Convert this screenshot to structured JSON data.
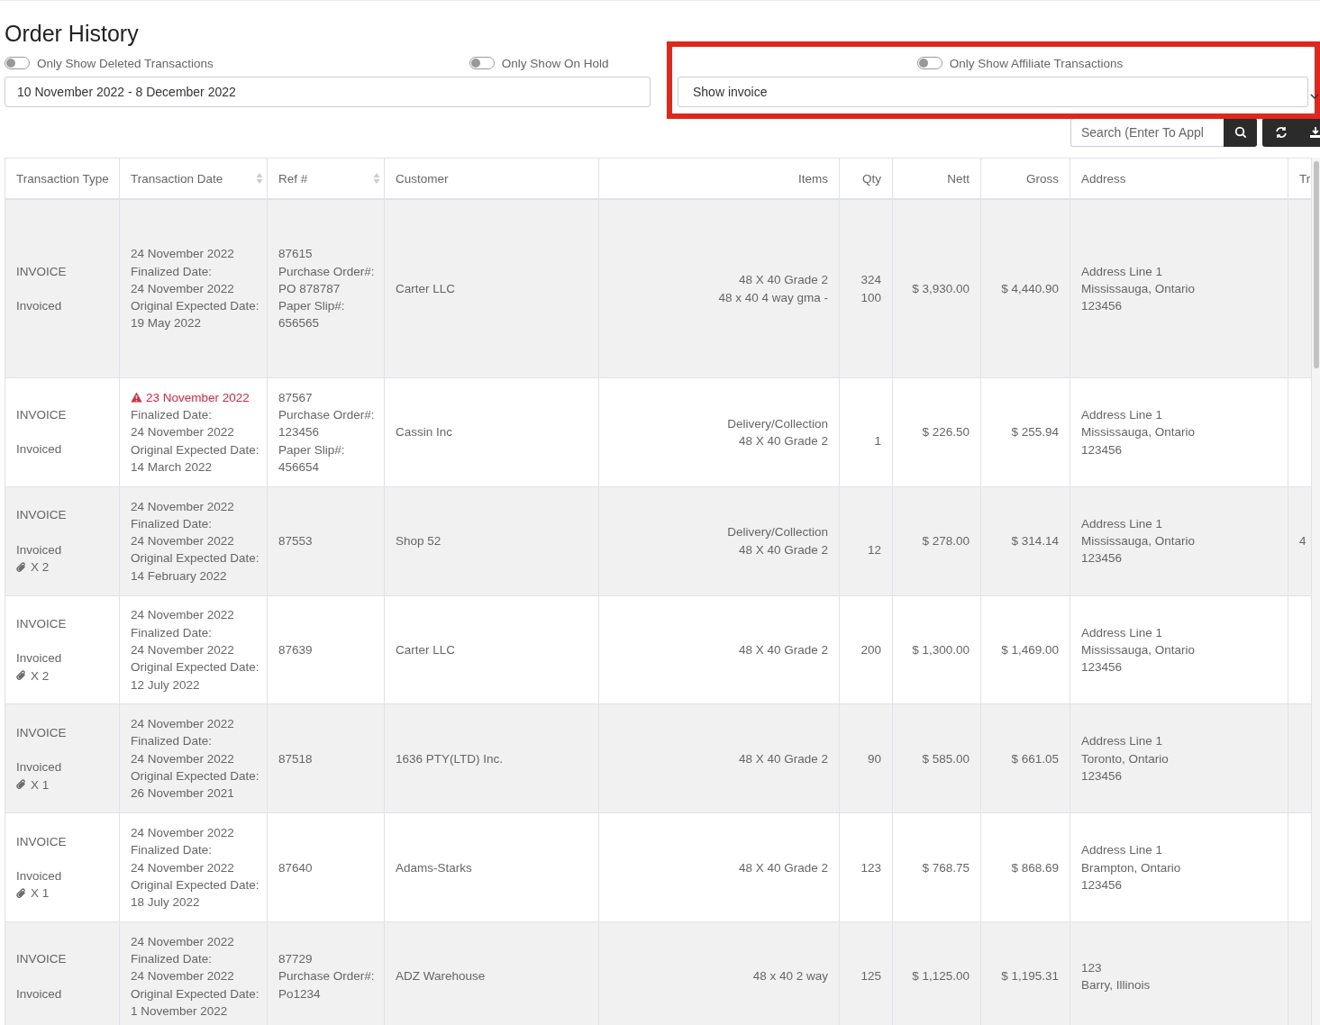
{
  "title": "Order History",
  "filters": [
    {
      "label": "Only Show Deleted Transactions",
      "on": false
    },
    {
      "label": "Only Show On Hold",
      "on": false
    },
    {
      "label": "Only Show Affiliate Transactions",
      "on": false
    }
  ],
  "date_range": {
    "value": "10 November 2022 - 8 December 2022"
  },
  "type_select": {
    "value": "Show invoice"
  },
  "search": {
    "placeholder": "Search (Enter To Appl"
  },
  "table": {
    "columns": [
      {
        "label": "Transaction Type",
        "sortable": false
      },
      {
        "label": "Transaction Date",
        "sortable": true
      },
      {
        "label": "Ref #",
        "sortable": true
      },
      {
        "label": "Customer",
        "sortable": false
      },
      {
        "label": "Items",
        "sortable": false
      },
      {
        "label": "Qty",
        "sortable": false
      },
      {
        "label": "Nett",
        "sortable": false
      },
      {
        "label": "Gross",
        "sortable": false
      },
      {
        "label": "Address",
        "sortable": false
      },
      {
        "label": "Tr",
        "sortable": false
      }
    ],
    "rows": [
      {
        "type": "INVOICE",
        "status": "Invoiced",
        "date": {
          "text": "24 November 2022",
          "warning": false
        },
        "date_details": [
          "Finalized Date:",
          "24 November 2022",
          "Original Expected Date:",
          "19 May 2022"
        ],
        "ref": [
          "87615",
          "Purchase Order#:",
          "PO 878787",
          "Paper Slip#:",
          "656565"
        ],
        "customer": "Carter LLC",
        "items": [
          "48 X 40 Grade 2",
          "48 x 40 4 way gma -"
        ],
        "qty": [
          "324",
          "100"
        ],
        "nett": "$ 3,930.00",
        "gross": "$ 4,440.90",
        "address": [
          "Address Line 1",
          "Mississauga, Ontario",
          "123456"
        ]
      },
      {
        "type": "INVOICE",
        "status": "Invoiced",
        "date": {
          "text": "23 November 2022",
          "warning": true
        },
        "date_details": [
          "Finalized Date:",
          "24 November 2022",
          "Original Expected Date:",
          "14 March 2022"
        ],
        "ref": [
          "87567",
          "Purchase Order#:",
          "123456",
          "Paper Slip#:",
          "456654"
        ],
        "customer": "Cassin Inc",
        "items": [
          "Delivery/Collection",
          "48 X 40 Grade 2"
        ],
        "qty": [
          "1"
        ],
        "nett": "$ 226.50",
        "gross": "$ 255.94",
        "address": [
          "Address Line 1",
          "Mississauga, Ontario",
          "123456"
        ]
      },
      {
        "type": "INVOICE",
        "status": "Invoiced",
        "attachments": "X 2",
        "date": {
          "text": "24 November 2022",
          "warning": false
        },
        "date_details": [
          "Finalized Date:",
          "24 November 2022",
          "Original Expected Date:",
          "14 February 2022"
        ],
        "ref": [
          "87553"
        ],
        "customer": "Shop 52",
        "items": [
          "Delivery/Collection",
          "48 X 40 Grade 2"
        ],
        "qty": [
          "12"
        ],
        "nett": "$ 278.00",
        "gross": "$ 314.14",
        "address": [
          "Address Line 1",
          "Mississauga, Ontario",
          "123456"
        ],
        "column_10": "4"
      },
      {
        "type": "INVOICE",
        "status": "Invoiced",
        "attachments": "X 2",
        "date": {
          "text": "24 November 2022",
          "warning": false
        },
        "date_details": [
          "Finalized Date:",
          "24 November 2022",
          "Original Expected Date:",
          "12 July 2022"
        ],
        "ref": [
          "87639"
        ],
        "customer": "Carter LLC",
        "items": [
          "48 X 40 Grade 2"
        ],
        "qty": [
          "200"
        ],
        "nett": "$ 1,300.00",
        "gross": "$ 1,469.00",
        "address": [
          "Address Line 1",
          "Mississauga, Ontario",
          "123456"
        ]
      },
      {
        "type": "INVOICE",
        "status": "Invoiced",
        "attachments": "X 1",
        "date": {
          "text": "24 November 2022",
          "warning": false
        },
        "date_details": [
          "Finalized Date:",
          "24 November 2022",
          "Original Expected Date:",
          "26 November 2021"
        ],
        "ref": [
          "87518"
        ],
        "customer": "1636 PTY(LTD) Inc.",
        "items": [
          "48 X 40 Grade 2"
        ],
        "qty": [
          "90"
        ],
        "nett": "$ 585.00",
        "gross": "$ 661.05",
        "address": [
          "Address Line 1",
          "Toronto, Ontario",
          "123456"
        ]
      },
      {
        "type": "INVOICE",
        "status": "Invoiced",
        "attachments": "X 1",
        "date": {
          "text": "24 November 2022",
          "warning": false
        },
        "date_details": [
          "Finalized Date:",
          "24 November 2022",
          "Original Expected Date:",
          "18 July 2022"
        ],
        "ref": [
          "87640"
        ],
        "customer": "Adams-Starks",
        "items": [
          "48 X 40 Grade 2"
        ],
        "qty": [
          "123"
        ],
        "nett": "$ 768.75",
        "gross": "$ 868.69",
        "address": [
          "Address Line 1",
          "Brampton, Ontario",
          "123456"
        ]
      },
      {
        "type": "INVOICE",
        "status": "Invoiced",
        "date": {
          "text": "24 November 2022",
          "warning": false
        },
        "date_details": [
          "Finalized Date:",
          "24 November 2022",
          "Original Expected Date:",
          "1 November 2022"
        ],
        "ref": [
          "87729",
          "Purchase Order#:",
          "Po1234"
        ],
        "customer": "ADZ Warehouse",
        "items": [
          "48 x 40 2 way"
        ],
        "qty": [
          "125"
        ],
        "nett": "$ 1,125.00",
        "gross": "$ 1,195.31",
        "address": [
          "123",
          "Barry, Illinois"
        ]
      }
    ]
  }
}
